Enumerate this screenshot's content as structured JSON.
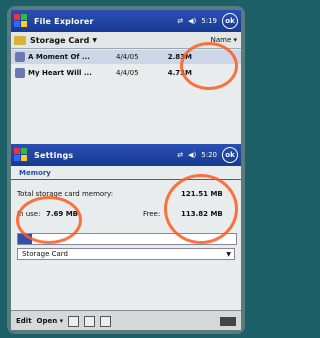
{
  "explorer": {
    "title": "File Explorer",
    "clock": "5:19",
    "ok": "ok",
    "location": "Storage Card",
    "sort": "Name",
    "files": [
      {
        "name": "A Moment Of ...",
        "date": "4/4/05",
        "size": "2.83M"
      },
      {
        "name": "My Heart Will ...",
        "date": "4/4/05",
        "size": "4.73M"
      }
    ]
  },
  "settings": {
    "title": "Settings",
    "clock": "5:20",
    "ok": "ok",
    "tab": "Memory",
    "total_label": "Total storage card memory:",
    "total_value": "121.51 MB",
    "in_use_label": "In use:",
    "in_use_value": "7.69 MB",
    "free_label": "Free:",
    "free_value": "113.82 MB",
    "usage_fraction": 0.063,
    "storage_option": "Storage Card"
  },
  "menubar": {
    "edit": "Edit",
    "open": "Open"
  },
  "colors": {
    "titlebar": "#1f45a3",
    "annotation": "#ff5a1f"
  }
}
